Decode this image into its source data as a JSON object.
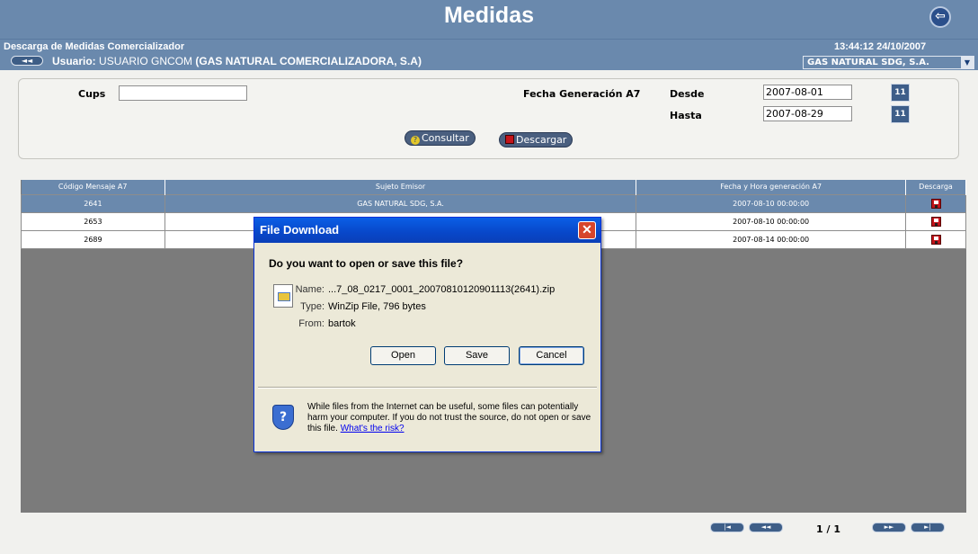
{
  "header": {
    "title": "Medidas",
    "subtitle": "Descarga de Medidas Comercializador",
    "datetime": "13:44:12 24/10/2007",
    "back_label": "◄◄",
    "user_label": "Usuario:",
    "user_name": "USUARIO GNCOM",
    "user_company": "(GAS NATURAL COMERCIALIZADORA, S.A)",
    "company_selected": "GAS NATURAL SDG, S.A."
  },
  "filters": {
    "cups_label": "Cups",
    "cups_value": "",
    "fecha_label": "Fecha Generación A7",
    "desde_label": "Desde",
    "desde_value": "2007-08-01",
    "hasta_label": "Hasta",
    "hasta_value": "2007-08-29",
    "calendar_text": "11",
    "consultar_label": "Consultar",
    "descargar_label": "Descargar"
  },
  "grid": {
    "columns": [
      "Código Mensaje A7",
      "Sujeto Emisor",
      "Fecha y Hora generación A7",
      "Descarga"
    ],
    "rows": [
      {
        "codigo": "2641",
        "emisor": "GAS NATURAL SDG, S.A.",
        "fecha": "2007-08-10 00:00:00",
        "selected": true
      },
      {
        "codigo": "2653",
        "emisor": "",
        "fecha": "2007-08-10 00:00:00",
        "selected": false
      },
      {
        "codigo": "2689",
        "emisor": "",
        "fecha": "2007-08-14 00:00:00",
        "selected": false
      }
    ]
  },
  "pagination": {
    "first": "|◄",
    "prev": "◄◄",
    "info": "1 / 1",
    "next": "►►",
    "last": "►|"
  },
  "dialog": {
    "title": "File Download",
    "close": "✕",
    "question": "Do you want to open or save this file?",
    "name_label": "Name:",
    "name_value": "...7_08_0217_0001_20070810120901113(2641).zip",
    "type_label": "Type:",
    "type_value": "WinZip File, 796 bytes",
    "from_label": "From:",
    "from_value": "bartok",
    "open_label": "Open",
    "save_label": "Save",
    "cancel_label": "Cancel",
    "warning": "While files from the Internet can be useful, some files can potentially harm your computer. If you do not trust the source, do not open or save this file.",
    "risk_link": "What's the risk?"
  }
}
